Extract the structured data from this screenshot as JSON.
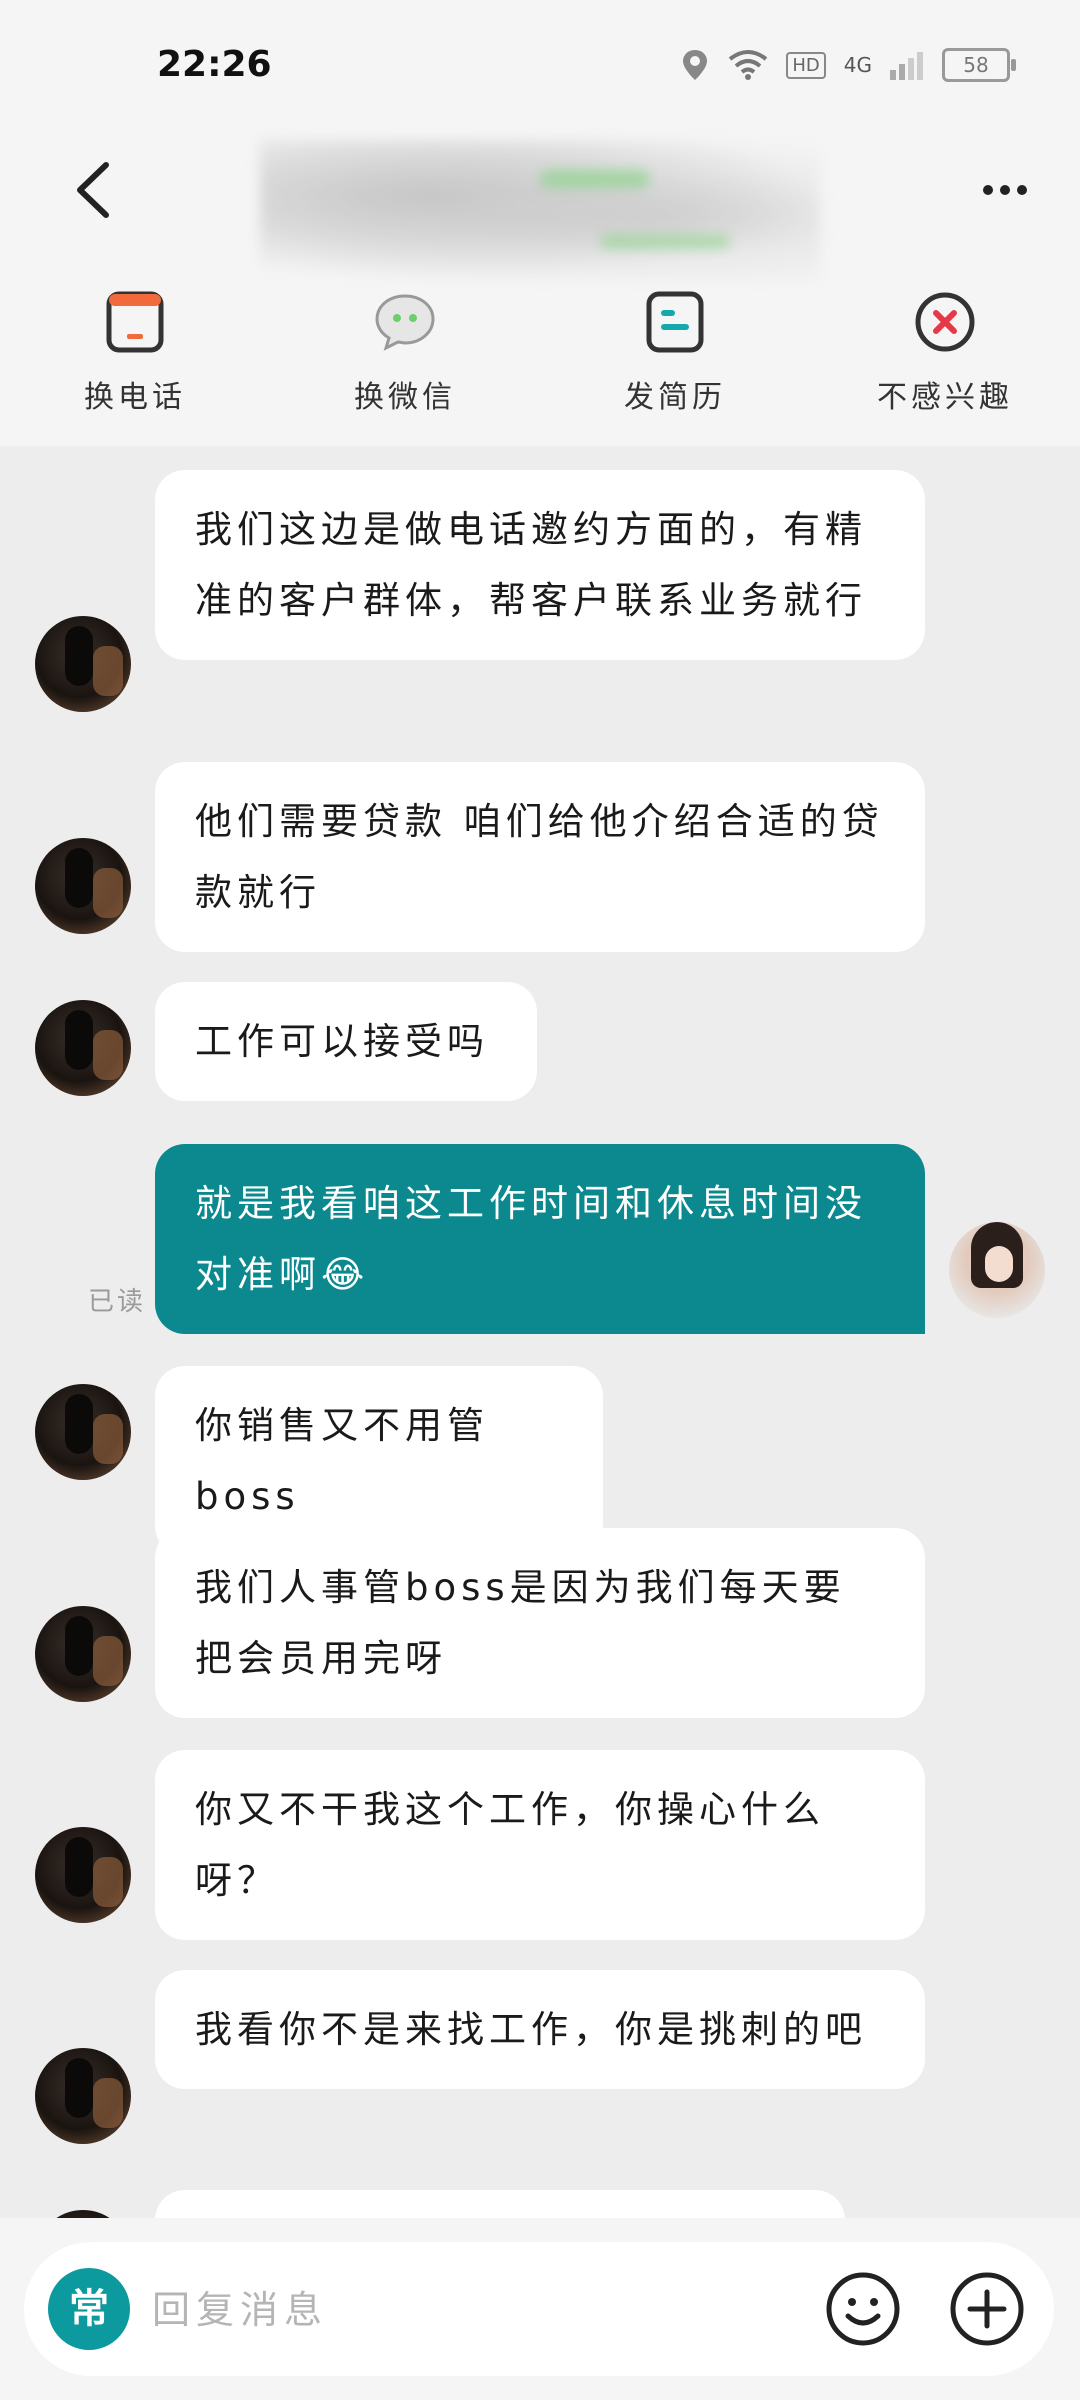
{
  "status": {
    "time": "22:26",
    "battery": "58",
    "hd": "HD",
    "network": "4G"
  },
  "header": {
    "actions": [
      {
        "label": "换电话",
        "icon": "phone-swap-icon"
      },
      {
        "label": "换微信",
        "icon": "wechat-icon"
      },
      {
        "label": "发简历",
        "icon": "resume-icon"
      },
      {
        "label": "不感兴趣",
        "icon": "not-interested-icon"
      }
    ]
  },
  "messages": [
    {
      "from": "other",
      "text": "我们这边是做电话邀约方面的，有精准的客户群体，帮客户联系业务就行"
    },
    {
      "from": "other",
      "text": "他们需要贷款 咱们给他介绍合适的贷款就行"
    },
    {
      "from": "other",
      "text": "工作可以接受吗"
    },
    {
      "from": "me",
      "text": "就是我看咱这工作时间和休息时间没对准啊😂",
      "status": "已读"
    },
    {
      "from": "other",
      "text": "你销售又不用管boss"
    },
    {
      "from": "other",
      "text": "我们人事管boss是因为我们每天要把会员用完呀"
    },
    {
      "from": "other",
      "text": "你又不干我这个工作，你操心什么呀？"
    },
    {
      "from": "other",
      "text": "我看你不是来找工作，你是挑刺的吧"
    }
  ],
  "composer": {
    "common_label": "常",
    "placeholder": "回复消息"
  },
  "colors": {
    "accent": "#0b898f",
    "background": "#ededed"
  }
}
